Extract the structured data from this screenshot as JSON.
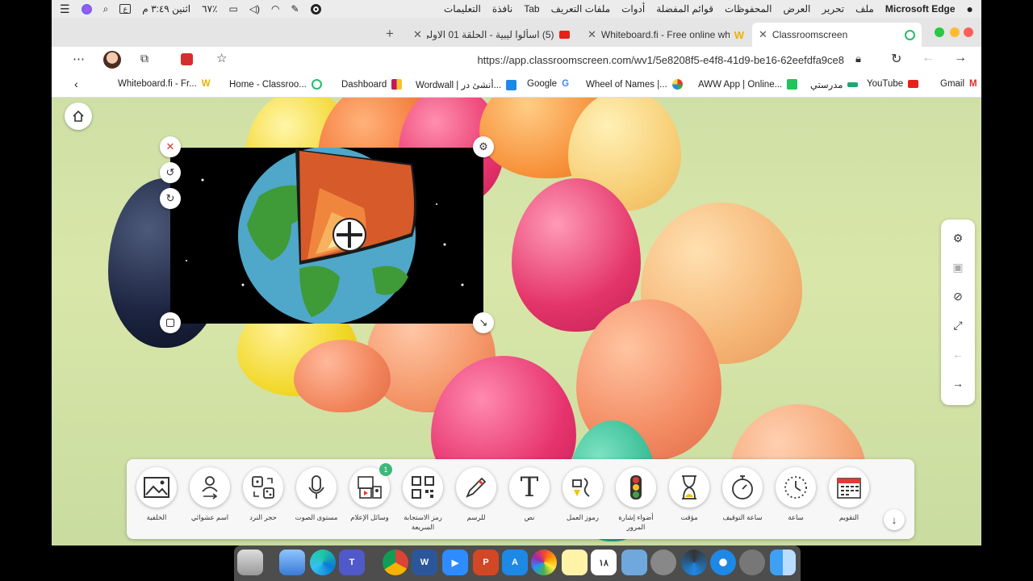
{
  "menubar": {
    "app_name": "Microsoft Edge",
    "menus": [
      "ملف",
      "تحرير",
      "العرض",
      "المحفوظات",
      "قوائم المفضلة",
      "أدوات",
      "ملفات التعريف",
      "Tab",
      "نافذة",
      "التعليمات"
    ],
    "clock": "اثنين ٣:٤٩ م",
    "battery": "٦٧٪",
    "input_indicator": "ع"
  },
  "tabs": [
    {
      "title": "(5) اسألوا ليبية - الحلقة 01 الاولى"
    },
    {
      "title": "Whiteboard.fi - Free online wh"
    },
    {
      "title": "Classroomscreen"
    }
  ],
  "address": {
    "url": "https://app.classroomscreen.com/wv1/5e8208f5-e4f8-41d9-be16-62eefdfa9ce8"
  },
  "favorites": [
    {
      "label": "Whiteboard.fi - Fr...",
      "icon": "whiteboard-icon",
      "color": "#e8b400"
    },
    {
      "label": "Home - Classroo...",
      "icon": "classroomscreen-icon",
      "color": "#22c06b"
    },
    {
      "label": "Dashboard",
      "icon": "dashboard-icon",
      "color": "#c2185b"
    },
    {
      "label": "Wordwall | أنشئ در...",
      "icon": "wordwall-icon",
      "color": "#1e88e5"
    },
    {
      "label": "Google",
      "icon": "google-icon",
      "color": "#4285f4"
    },
    {
      "label": "Wheel of Names |...",
      "icon": "wheel-icon",
      "color": "#e53935"
    },
    {
      "label": "AWW App | Online...",
      "icon": "aww-icon",
      "color": "#21c45b"
    },
    {
      "label": "مدرستي",
      "icon": "madrasati-icon",
      "color": "#19a974"
    },
    {
      "label": "YouTube",
      "icon": "youtube-icon",
      "color": "#e62117"
    },
    {
      "label": "Gmail",
      "icon": "gmail-icon",
      "color": "#d93025"
    }
  ],
  "tools": [
    {
      "label": "الخلفية",
      "icon": "background-image-icon"
    },
    {
      "label": "اسم عشوائي",
      "icon": "random-name-icon"
    },
    {
      "label": "حجر النرد",
      "icon": "dice-icon"
    },
    {
      "label": "مستوى الصوت",
      "icon": "microphone-icon"
    },
    {
      "label": "وسائل الإعلام",
      "icon": "media-icon",
      "badge": "1"
    },
    {
      "label": "رمز الاستجابة السريعة",
      "icon": "qr-code-icon"
    },
    {
      "label": "للرسم",
      "icon": "pencil-icon"
    },
    {
      "label": "نص",
      "icon": "text-icon"
    },
    {
      "label": "رموز العمل",
      "icon": "work-symbols-icon"
    },
    {
      "label": "أضواء إشارة المرور",
      "icon": "traffic-light-icon"
    },
    {
      "label": "مؤقت",
      "icon": "hourglass-icon"
    },
    {
      "label": "ساعة التوقيف",
      "icon": "stopwatch-icon"
    },
    {
      "label": "ساعة",
      "icon": "clock-icon"
    },
    {
      "label": "التقويم",
      "icon": "calendar-icon"
    }
  ],
  "dock": [
    {
      "icon": "trash-icon"
    },
    {
      "icon": "preview-icon"
    },
    {
      "icon": "edge-icon"
    },
    {
      "icon": "teams-icon"
    },
    {
      "icon": "chrome-icon"
    },
    {
      "icon": "word-icon"
    },
    {
      "icon": "zoom-icon"
    },
    {
      "icon": "powerpoint-icon"
    },
    {
      "icon": "app-store-icon"
    },
    {
      "icon": "photos-icon"
    },
    {
      "icon": "notes-icon"
    },
    {
      "icon": "calendar-app-icon",
      "text": "١٨"
    },
    {
      "icon": "keynote-icon"
    },
    {
      "icon": "system-preferences-icon"
    },
    {
      "icon": "edge-beta-icon"
    },
    {
      "icon": "safari-icon"
    },
    {
      "icon": "launchpad-icon"
    },
    {
      "icon": "finder-icon"
    }
  ]
}
